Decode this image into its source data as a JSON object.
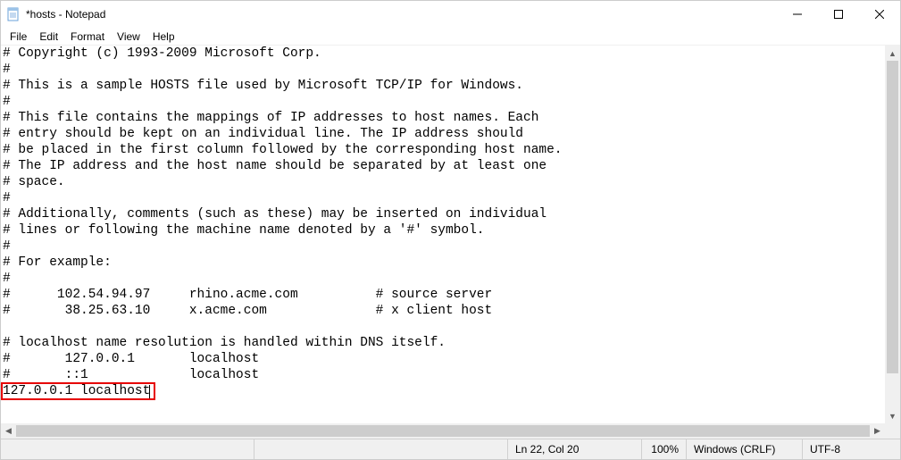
{
  "window": {
    "title": "*hosts - Notepad"
  },
  "menu": {
    "file": "File",
    "edit": "Edit",
    "format": "Format",
    "view": "View",
    "help": "Help"
  },
  "editor": {
    "lines": [
      "# Copyright (c) 1993-2009 Microsoft Corp.",
      "#",
      "# This is a sample HOSTS file used by Microsoft TCP/IP for Windows.",
      "#",
      "# This file contains the mappings of IP addresses to host names. Each",
      "# entry should be kept on an individual line. The IP address should",
      "# be placed in the first column followed by the corresponding host name.",
      "# The IP address and the host name should be separated by at least one",
      "# space.",
      "#",
      "# Additionally, comments (such as these) may be inserted on individual",
      "# lines or following the machine name denoted by a '#' symbol.",
      "#",
      "# For example:",
      "#",
      "#      102.54.94.97     rhino.acme.com          # source server",
      "#       38.25.63.10     x.acme.com              # x client host",
      "",
      "# localhost name resolution is handled within DNS itself.",
      "#       127.0.0.1       localhost",
      "#       ::1             localhost",
      "127.0.0.1 localhost"
    ],
    "highlighted_line_index": 21
  },
  "status": {
    "position": "Ln 22, Col 20",
    "zoom": "100%",
    "eol": "Windows (CRLF)",
    "encoding": "UTF-8"
  }
}
